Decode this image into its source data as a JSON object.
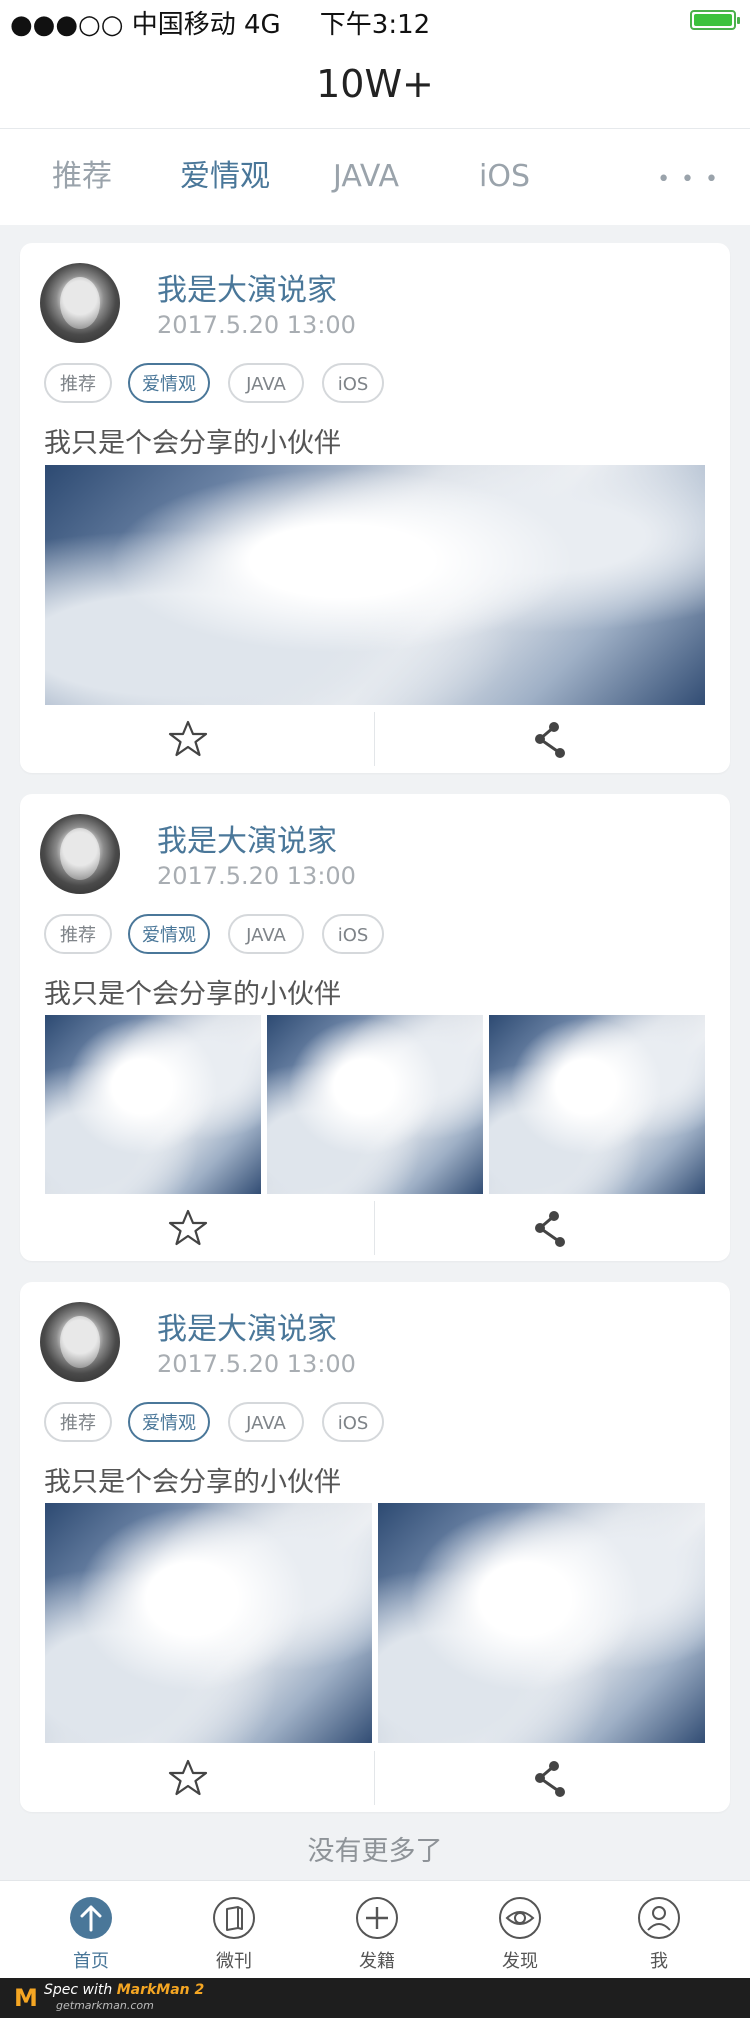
{
  "status_bar": {
    "signal": "●●●○○",
    "carrier": "中国移动",
    "network": "4G",
    "time": "下午3:12"
  },
  "nav": {
    "title": "10W+"
  },
  "tabs": [
    {
      "label": "推荐",
      "active": false
    },
    {
      "label": "爱情观",
      "active": true
    },
    {
      "label": "JAVA",
      "active": false
    },
    {
      "label": "iOS",
      "active": false
    }
  ],
  "tabs_more": "• • •",
  "posts": [
    {
      "author": "我是大演说家",
      "date": "2017.5.20   13:00",
      "tags": [
        "推荐",
        "爱情观",
        "JAVA",
        "iOS"
      ],
      "active_tag": "爱情观",
      "text": "我只是个会分享的小伙伴",
      "image_count": 1
    },
    {
      "author": "我是大演说家",
      "date": "2017.5.20   13:00",
      "tags": [
        "推荐",
        "爱情观",
        "JAVA",
        "iOS"
      ],
      "active_tag": "爱情观",
      "text": "我只是个会分享的小伙伴",
      "image_count": 3
    },
    {
      "author": "我是大演说家",
      "date": "2017.5.20   13:00",
      "tags": [
        "推荐",
        "爱情观",
        "JAVA",
        "iOS"
      ],
      "active_tag": "爱情观",
      "text": "我只是个会分享的小伙伴",
      "image_count": 2
    }
  ],
  "icons": {
    "favorite": "star-icon",
    "share": "share-icon"
  },
  "end_text": "没有更多了",
  "bottom_nav": [
    {
      "label": "首页",
      "icon": "home-icon",
      "active": true
    },
    {
      "label": "微刊",
      "icon": "book-icon",
      "active": false
    },
    {
      "label": "发籍",
      "icon": "plus-icon",
      "active": false
    },
    {
      "label": "发现",
      "icon": "eye-icon",
      "active": false
    },
    {
      "label": "我",
      "icon": "user-icon",
      "active": false
    }
  ],
  "watermark": {
    "line1": "Spec with",
    "brand": "MarkMan 2",
    "line2": "getmarkman.com"
  },
  "colors": {
    "accent": "#4a7799",
    "background": "#f0f2f4",
    "muted": "#a8adb2"
  }
}
